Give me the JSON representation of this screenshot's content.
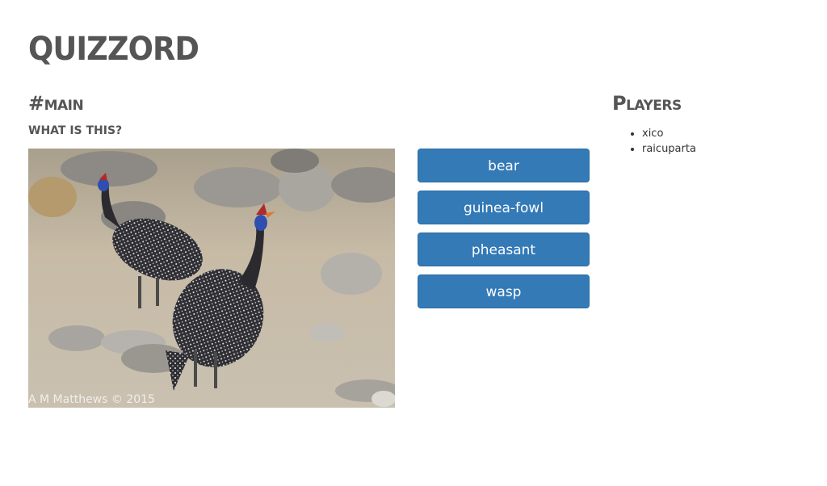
{
  "app": {
    "title": "Quizzord"
  },
  "room": {
    "name": "#main"
  },
  "quiz": {
    "question": "What is this?",
    "image": {
      "credit": "A M Matthews © 2015"
    },
    "answers": [
      {
        "label": "bear"
      },
      {
        "label": "guinea-fowl"
      },
      {
        "label": "pheasant"
      },
      {
        "label": "wasp"
      }
    ],
    "button_color": "#337ab7"
  },
  "players": {
    "title": "Players",
    "items": [
      "xico",
      "raicuparta"
    ]
  }
}
